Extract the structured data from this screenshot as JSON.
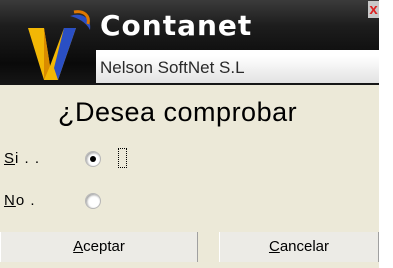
{
  "app": {
    "title": "Contanet",
    "company": "Nelson SoftNet S.L",
    "close_glyph": "x",
    "logo_icon": "contanet-logo-icon",
    "banner_color": "#1a1a1a",
    "logo_colors": [
      "#2340a8",
      "#f4b400",
      "#e07800"
    ]
  },
  "dialog": {
    "question": "¿Desea comprobar",
    "options": [
      {
        "accel": "S",
        "rest": "i . .",
        "selected": true
      },
      {
        "accel": "N",
        "rest": "o .",
        "selected": false
      }
    ],
    "buttons": [
      {
        "accel": "A",
        "rest": "ceptar"
      },
      {
        "accel": "C",
        "rest": "ancelar"
      }
    ]
  }
}
